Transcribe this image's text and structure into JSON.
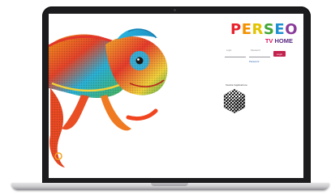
{
  "brand": {
    "letters": [
      {
        "char": "P",
        "color": "#e8232f"
      },
      {
        "char": "E",
        "color": "#f39200"
      },
      {
        "char": "R",
        "color": "#e2c400"
      },
      {
        "char": "S",
        "color": "#3fa535"
      },
      {
        "char": "E",
        "color": "#1e8fd2"
      },
      {
        "char": "O",
        "color": "#8a3a9a"
      }
    ],
    "sub_tv": "TV",
    "sub_home": "HOME",
    "accent": "#d8145e",
    "secondary": "#5a2a82"
  },
  "login": {
    "username_label": "Login",
    "password_label": "Password",
    "button_label": "Login",
    "forgot_link": "Password",
    "button_color": "#c4224e"
  },
  "qr": {
    "caption": "Scarica l'applicazione"
  },
  "illustration": {
    "subject": "chameleon",
    "colors": [
      "#e8342a",
      "#f7a21b",
      "#2bb3d8",
      "#4fb84a",
      "#f06a1e"
    ]
  }
}
